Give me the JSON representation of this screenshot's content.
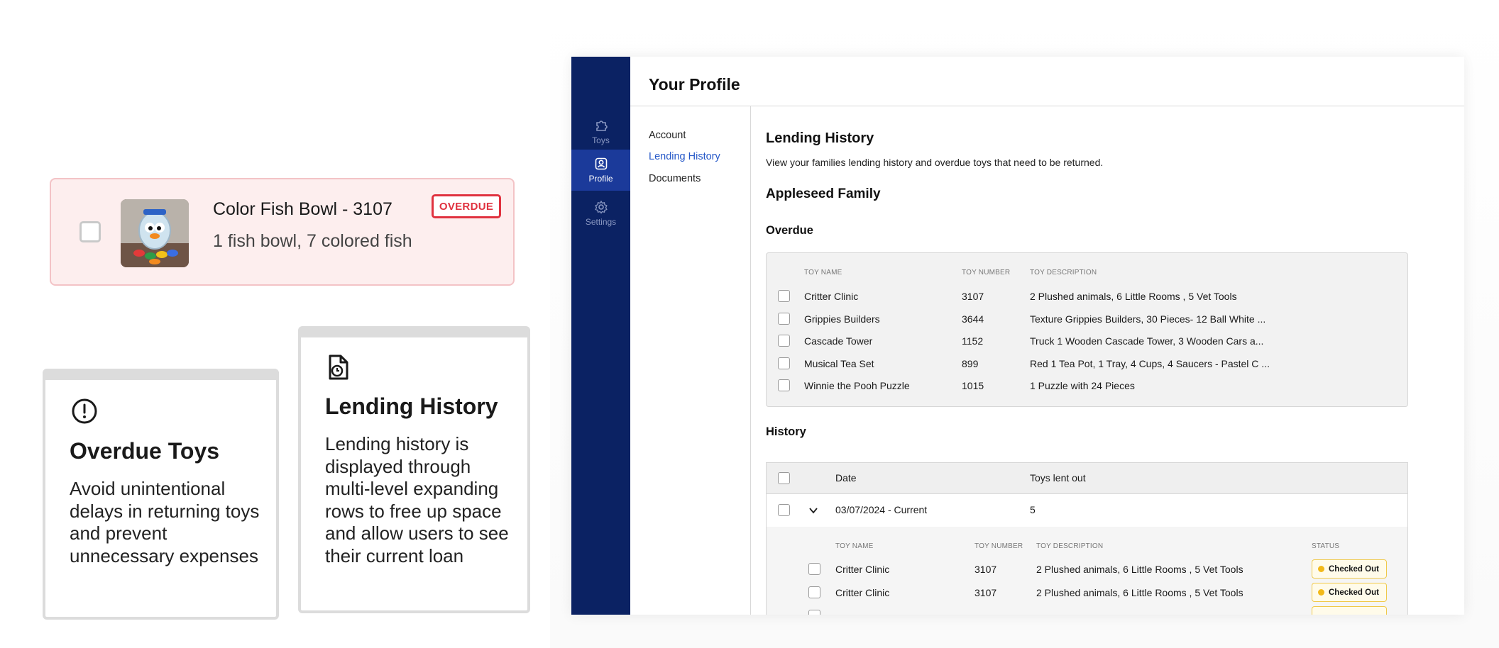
{
  "showcase": {
    "toy_card": {
      "name": "Color Fish Bowl - 3107",
      "description": "1 fish bowl, 7 colored fish",
      "badge": "OVERDUE"
    },
    "overdue_card": {
      "title": "Overdue Toys",
      "body": "Avoid unintentional delays in returning toys and prevent unnecessary expenses",
      "icon": "alert-circle-icon"
    },
    "lending_card": {
      "title": "Lending History",
      "body": "Lending history is displayed through multi-level expanding rows to free up space and allow users to see their current loan",
      "icon": "document-clock-icon"
    }
  },
  "app": {
    "rail": [
      {
        "label": "Toys",
        "icon": "puzzle-icon",
        "active": false
      },
      {
        "label": "Profile",
        "icon": "profile-icon",
        "active": true
      },
      {
        "label": "Settings",
        "icon": "gear-icon",
        "active": false
      }
    ],
    "page_title": "Your Profile",
    "subnav": {
      "account": "Account",
      "lending_history": "Lending History",
      "documents": "Documents"
    },
    "content": {
      "title": "Lending History",
      "subtitle": "View your families lending history and overdue toys that need to be returned.",
      "family": "Appleseed Family",
      "overdue_label": "Overdue",
      "overdue_table": {
        "headers": [
          "TOY NAME",
          "TOY NUMBER",
          "TOY DESCRIPTION"
        ],
        "rows": [
          [
            "Critter Clinic",
            "3107",
            "2 Plushed animals, 6 Little Rooms , 5 Vet Tools"
          ],
          [
            "Grippies Builders",
            "3644",
            "Texture Grippies Builders, 30 Pieces- 12 Ball White ..."
          ],
          [
            "Cascade Tower",
            "1152",
            "Truck  1 Wooden Cascade Tower, 3 Wooden Cars a..."
          ],
          [
            "Musical Tea Set",
            "899",
            "Red 1 Tea Pot, 1 Tray, 4 Cups, 4 Saucers - Pastel C ..."
          ],
          [
            "Winnie the Pooh Puzzle",
            "1015",
            "1 Puzzle with 24 Pieces"
          ]
        ]
      },
      "history_label": "History",
      "history_table": {
        "headers": [
          "Date",
          "Toys lent out"
        ],
        "row": {
          "date": "03/07/2024 - Current",
          "count": "5"
        },
        "sub_headers": [
          "TOY NAME",
          "TOY NUMBER",
          "TOY DESCRIPTION",
          "STATUS"
        ],
        "sub_rows": [
          [
            "Critter Clinic",
            "3107",
            "2 Plushed animals, 6 Little Rooms , 5 Vet Tools",
            "Checked Out"
          ],
          [
            "Critter Clinic",
            "3107",
            "2 Plushed animals, 6 Little Rooms , 5 Vet Tools",
            "Checked Out"
          ]
        ]
      }
    }
  },
  "colors": {
    "rail": "#0b2263",
    "rail_active": "#1b3a9a",
    "overdue_red": "#e0323f",
    "link_blue": "#2558c8",
    "status_yellow": "#f2b91a"
  }
}
